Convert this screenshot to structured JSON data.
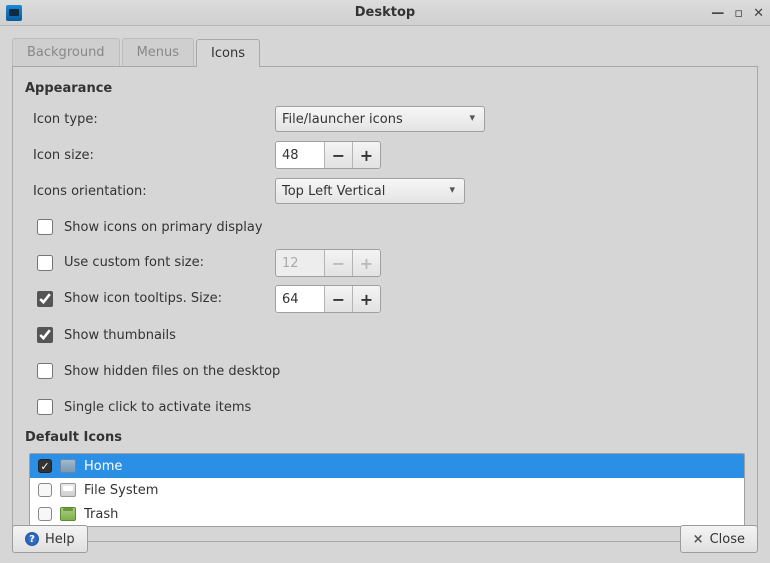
{
  "window": {
    "title": "Desktop"
  },
  "tabs": {
    "background": "Background",
    "menus": "Menus",
    "icons": "Icons",
    "active": "icons"
  },
  "appearance": {
    "heading": "Appearance",
    "icon_type_label": "Icon type:",
    "icon_type_value": "File/launcher icons",
    "icon_size_label": "Icon size:",
    "icon_size_value": "48",
    "orientation_label": "Icons orientation:",
    "orientation_value": "Top Left Vertical",
    "primary_display": {
      "label": "Show icons on primary display",
      "checked": false
    },
    "custom_font": {
      "label": "Use custom font size:",
      "checked": false,
      "value": "12"
    },
    "tooltips": {
      "label": "Show icon tooltips. Size:",
      "checked": true,
      "value": "64"
    },
    "thumbnails": {
      "label": "Show thumbnails",
      "checked": true
    },
    "hidden": {
      "label": "Show hidden files on the desktop",
      "checked": false
    },
    "single_click": {
      "label": "Single click to activate items",
      "checked": false
    }
  },
  "default_icons": {
    "heading": "Default Icons",
    "items": [
      {
        "label": "Home",
        "checked": true,
        "selected": true,
        "icon": "folder"
      },
      {
        "label": "File System",
        "checked": false,
        "selected": false,
        "icon": "drive"
      },
      {
        "label": "Trash",
        "checked": false,
        "selected": false,
        "icon": "trash"
      }
    ]
  },
  "footer": {
    "help": "Help",
    "close": "Close"
  }
}
